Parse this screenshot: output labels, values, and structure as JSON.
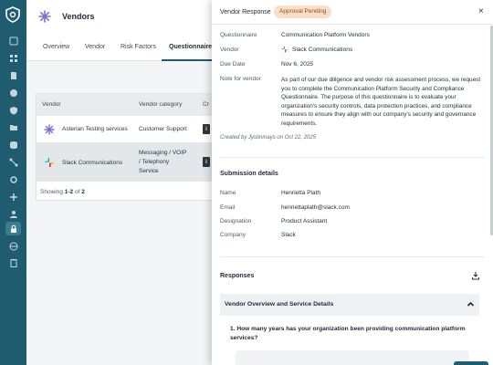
{
  "nav": {
    "items": [
      "home",
      "vendors-grid",
      "documents",
      "reports",
      "shield",
      "folders",
      "database",
      "connections",
      "settings",
      "network",
      "users",
      "lock",
      "globe",
      "clipboard"
    ],
    "active": "lock"
  },
  "page": {
    "title": "Vendors",
    "tabs": [
      "Overview",
      "Vendor",
      "Risk Factors",
      "Questionnaire"
    ],
    "active_tab": "Questionnaire"
  },
  "table": {
    "columns": [
      "Vendor",
      "Vendor category",
      "Cr"
    ],
    "rows": [
      {
        "vendor": "Asterian Testing services",
        "category": "Customer Support"
      },
      {
        "vendor": "Slack Communications",
        "category_lines": [
          "Messaging / VOIP",
          "/ Telephony",
          "Service"
        ]
      }
    ],
    "footer_prefix": "Showing ",
    "footer_range": "1-2",
    "footer_mid": " of ",
    "footer_total": "2"
  },
  "drawer": {
    "title": "Vendor Response",
    "status_badge": "Approval Pending",
    "close_label": "×",
    "fields": {
      "questionnaire_label": "Questionnaire",
      "questionnaire_value": "Communication Platform Vendors",
      "vendor_label": "Vendor",
      "vendor_value": "Slack Communications",
      "due_date_label": "Due Date",
      "due_date_value": "Nov 6, 2025",
      "note_label": "Note for vendor",
      "note_value": "As part of our due diligence and vendor risk assessment process, we request you to complete the Communication Platform Security and Compliance Questionnaire. The purpose of this questionnaire is to evaluate your organization's security controls, data protection practices, and compliance measures to ensure they align with our company's security and governance requirements."
    },
    "created_by": "Created by Jystinmays on Oct 22, 2025",
    "submission": {
      "title": "Submission details",
      "name_label": "Name",
      "name_value": "Henrietta Plath",
      "email_label": "Email",
      "email_value": "henriettaplath@slack.com",
      "designation_label": "Designation",
      "designation_value": "Product Assistant",
      "company_label": "Company",
      "company_value": "Slack"
    },
    "responses": {
      "title": "Responses",
      "section_title": "Vendor Overview and Service Details",
      "question": "1. How many years has your organization been providing communication platform services?"
    }
  },
  "colors": {
    "rail": "#1f5c70",
    "accent": "#1f5c70",
    "badge_bg": "#f9dfc9",
    "badge_text": "#9b4a12"
  }
}
